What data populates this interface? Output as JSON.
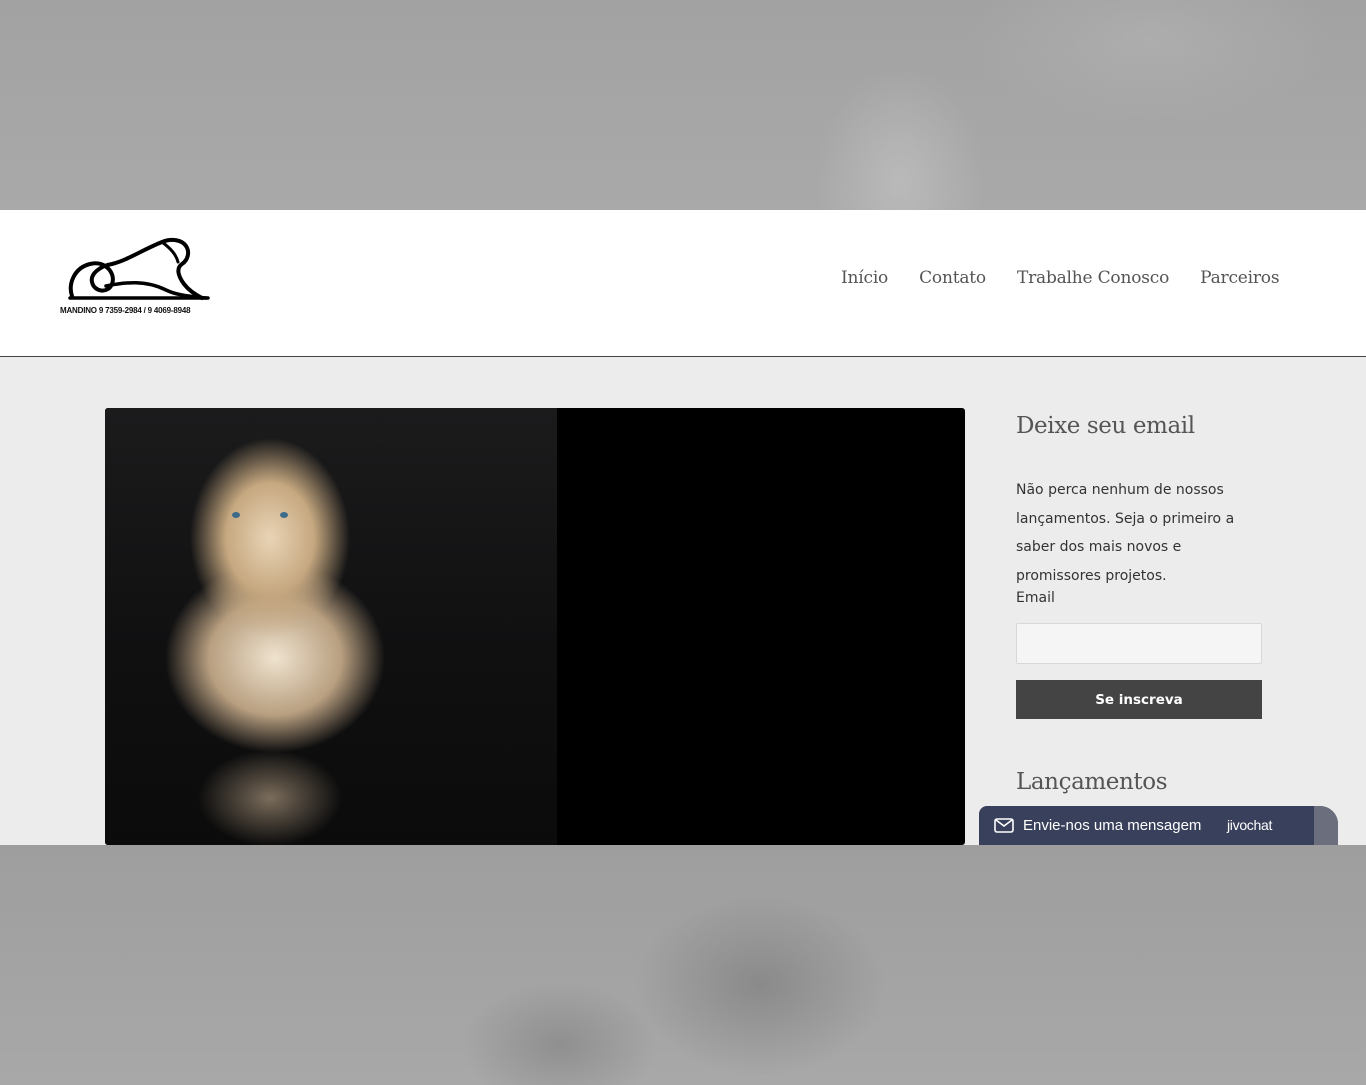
{
  "header": {
    "logo_phone": "MANDINO 9 7359-2984 / 9 4069-8948",
    "nav": [
      {
        "label": "Início"
      },
      {
        "label": "Contato"
      },
      {
        "label": "Trabalhe Conosco"
      },
      {
        "label": "Parceiros"
      }
    ]
  },
  "sidebar": {
    "subscribe_title": "Deixe seu email",
    "subscribe_text": "Não perca nenhum de nossos lançamentos. Seja o primeiro a saber dos mais novos e promissores projetos.",
    "email_label": "Email",
    "email_value": "",
    "subscribe_button": "Se inscreva",
    "releases_title": "Lançamentos"
  },
  "chat": {
    "label": "Envie-nos uma mensagem",
    "brand": "jivochat"
  },
  "colors": {
    "header_bg": "#ffffff",
    "content_bg": "#ececec",
    "button_bg": "#444444",
    "chat_bg": "#39405b"
  }
}
